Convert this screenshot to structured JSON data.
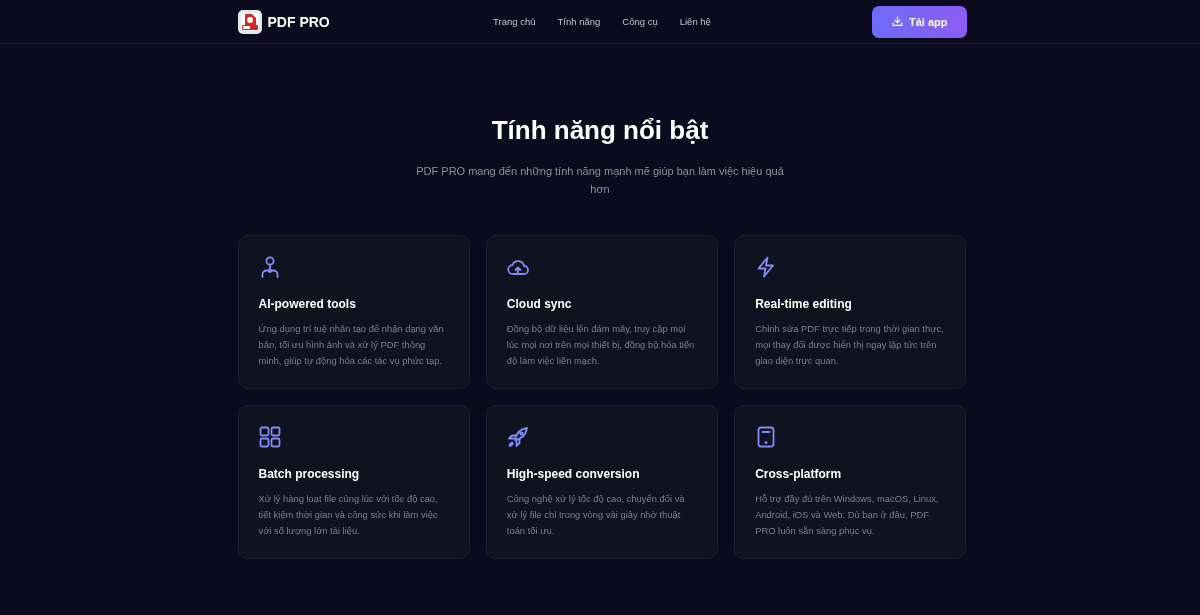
{
  "header": {
    "brand": "PDF PRO",
    "nav": [
      "Trang chủ",
      "Tính năng",
      "Công cụ",
      "Liên hệ"
    ],
    "cta": "Tải app"
  },
  "hero": {
    "title": "Tính năng nổi bật",
    "subtitle": "PDF PRO mang đến những tính năng mạnh mẽ giúp bạn làm việc hiệu quả hơn"
  },
  "features": [
    {
      "kind": "ai",
      "title": "AI-powered tools",
      "description": "Ứng dụng trí tuệ nhân tạo để nhận dạng văn bản, tối ưu hình ảnh và xử lý PDF thông minh, giúp tự động hóa các tác vụ phức tạp."
    },
    {
      "kind": "cloud",
      "title": "Cloud sync",
      "description": "Đồng bộ dữ liệu lên đám mây, truy cập mọi lúc mọi nơi trên mọi thiết bị, đồng bộ hóa tiến độ làm việc liền mạch."
    },
    {
      "kind": "bolt",
      "title": "Real-time editing",
      "description": "Chỉnh sửa PDF trực tiếp trong thời gian thực, mọi thay đổi được hiển thị ngay lập tức trên giao diện trực quan."
    },
    {
      "kind": "grid",
      "title": "Batch processing",
      "description": "Xử lý hàng loạt file cùng lúc với tốc độ cao, tiết kiệm thời gian và công sức khi làm việc với số lượng lớn tài liệu."
    },
    {
      "kind": "rocket",
      "title": "High-speed conversion",
      "description": "Công nghệ xử lý tốc độ cao, chuyển đổi và xử lý file chỉ trong vòng vài giây nhờ thuật toán tối ưu."
    },
    {
      "kind": "device",
      "title": "Cross-platform",
      "description": "Hỗ trợ đầy đủ trên Windows, macOS, Linux, Android, iOS và Web. Dù bạn ở đâu, PDF PRO luôn sẵn sàng phục vụ."
    }
  ]
}
